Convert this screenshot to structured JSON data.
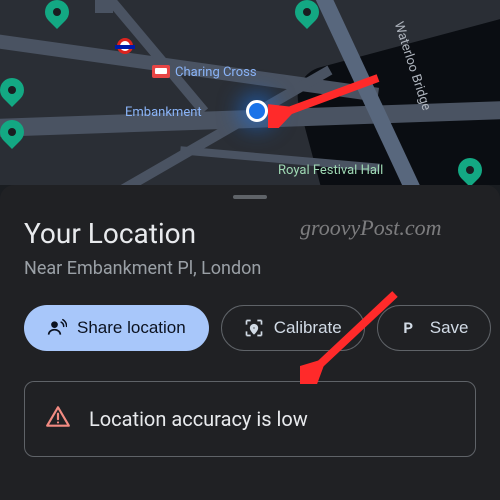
{
  "map": {
    "labels": {
      "charing_cross": "Charing Cross",
      "embankment": "Embankment",
      "royal_hall": "Royal Festival Hall",
      "bridge": "Waterloo Bridge"
    }
  },
  "panel": {
    "title": "Your Location",
    "subtitle": "Near Embankment Pl, London",
    "chips": {
      "share": "Share location",
      "calibrate": "Calibrate",
      "save": "Save"
    },
    "warning": "Location accuracy is low"
  },
  "watermark": "groovyPost.com"
}
